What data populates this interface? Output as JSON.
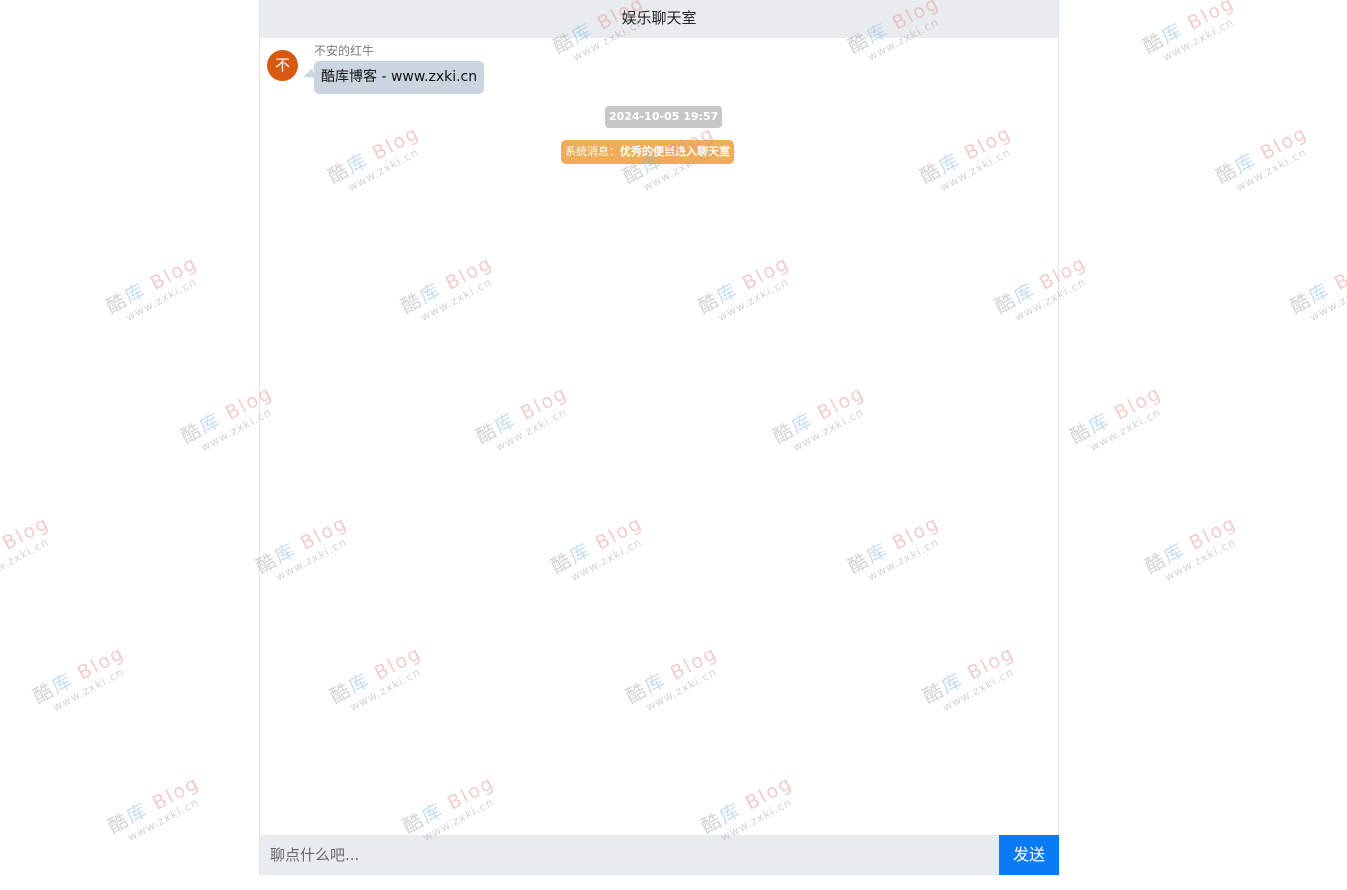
{
  "header": {
    "title": "娱乐聊天室"
  },
  "messages": [
    {
      "avatar_text": "不",
      "sender": "不安的红牛",
      "text": "酷库博客 - www.zxki.cn",
      "avatar_color": "#d65a12",
      "bubble_color": "#cbd5e0"
    }
  ],
  "timestamp": "2024-10-05 19:57",
  "system_message": {
    "prefix": "系统消息：",
    "text": "优秀的便当进入聊天室",
    "color": "#efad5a"
  },
  "input": {
    "placeholder": "聊点什么吧...",
    "value": ""
  },
  "send_button": {
    "label": "发送",
    "color": "#0a7bf5"
  },
  "watermark": {
    "brand_1": "酷",
    "brand_2": "库",
    "brand_3": "Blog",
    "url": "www.zxki.cn"
  }
}
